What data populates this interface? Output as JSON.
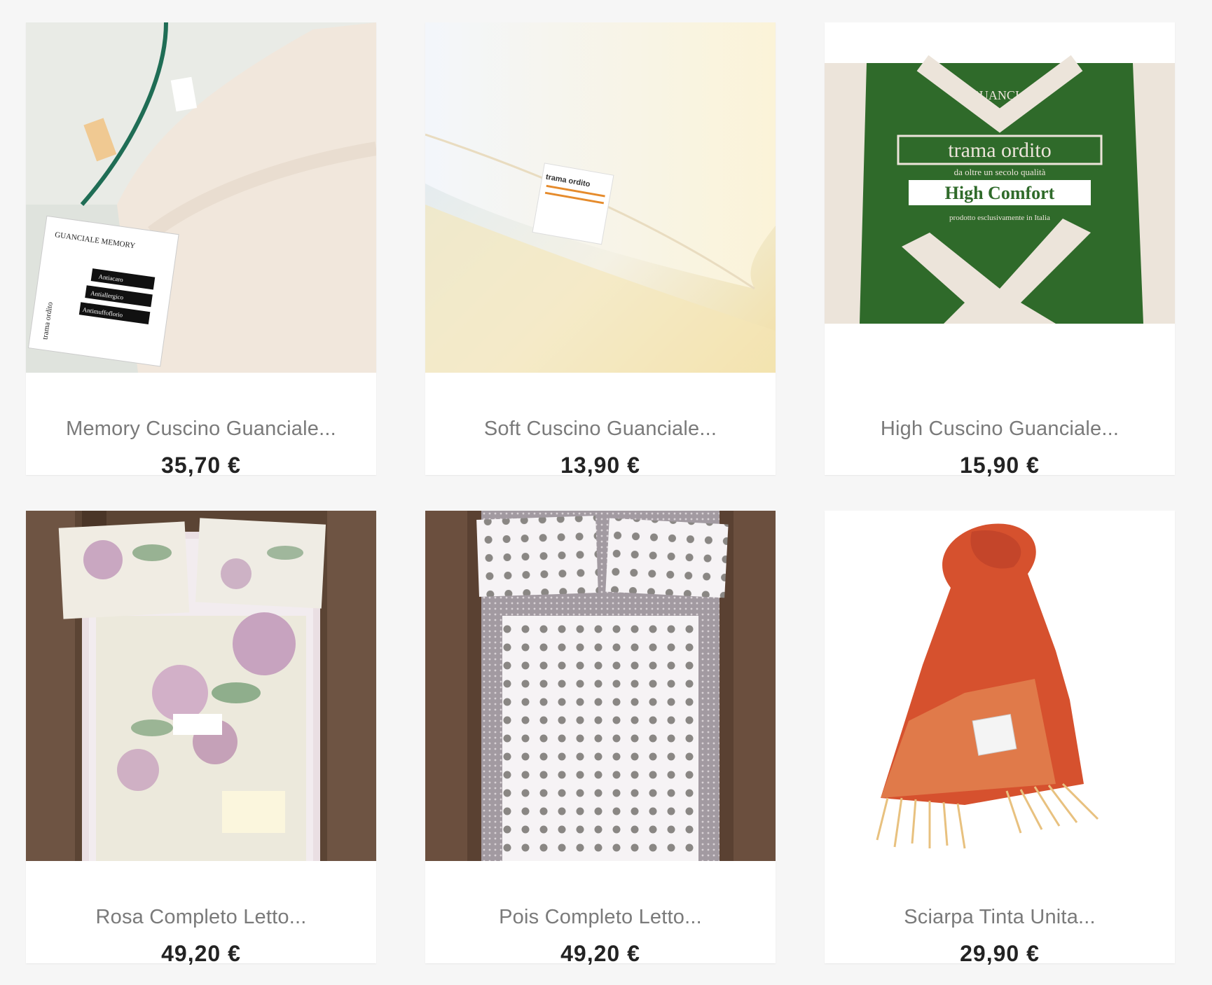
{
  "products": [
    {
      "title": "Memory Cuscino Guanciale...",
      "price": "35,70 €",
      "image": "memory-pillow-image",
      "image_text": {
        "label_title": "GUANCIALE MEMORY",
        "tags": [
          "Antiacaro",
          "Antiallergico",
          "Antimuffoflorio"
        ],
        "brand": "trama ordito"
      }
    },
    {
      "title": "Soft Cuscino Guanciale...",
      "price": "13,90 €",
      "image": "soft-pillow-image",
      "image_text": {
        "brand": "trama ordito"
      }
    },
    {
      "title": "High Cuscino Guanciale...",
      "price": "15,90 €",
      "image": "high-pillow-package-image",
      "image_text": {
        "label_title": "IL GUANCIALE",
        "brand": "trama ordito",
        "subtitle": "da oltre un secolo qualità",
        "product_name": "High Comfort",
        "origin": "prodotto esclusivamente in Italia"
      }
    },
    {
      "title": "Rosa Completo Letto...",
      "price": "49,20 €",
      "image": "rosa-floral-bedding-image"
    },
    {
      "title": "Pois Completo Letto...",
      "price": "49,20 €",
      "image": "pois-polka-dot-bedding-image"
    },
    {
      "title": "Sciarpa Tinta Unita...",
      "price": "29,90 €",
      "image": "orange-scarf-image"
    }
  ],
  "colors": {
    "background": "#f6f6f6",
    "card": "#ffffff",
    "title": "#7a7a7a",
    "price": "#232323",
    "brand_green": "#2f6a2a",
    "scarf_orange": "#d9542f"
  }
}
